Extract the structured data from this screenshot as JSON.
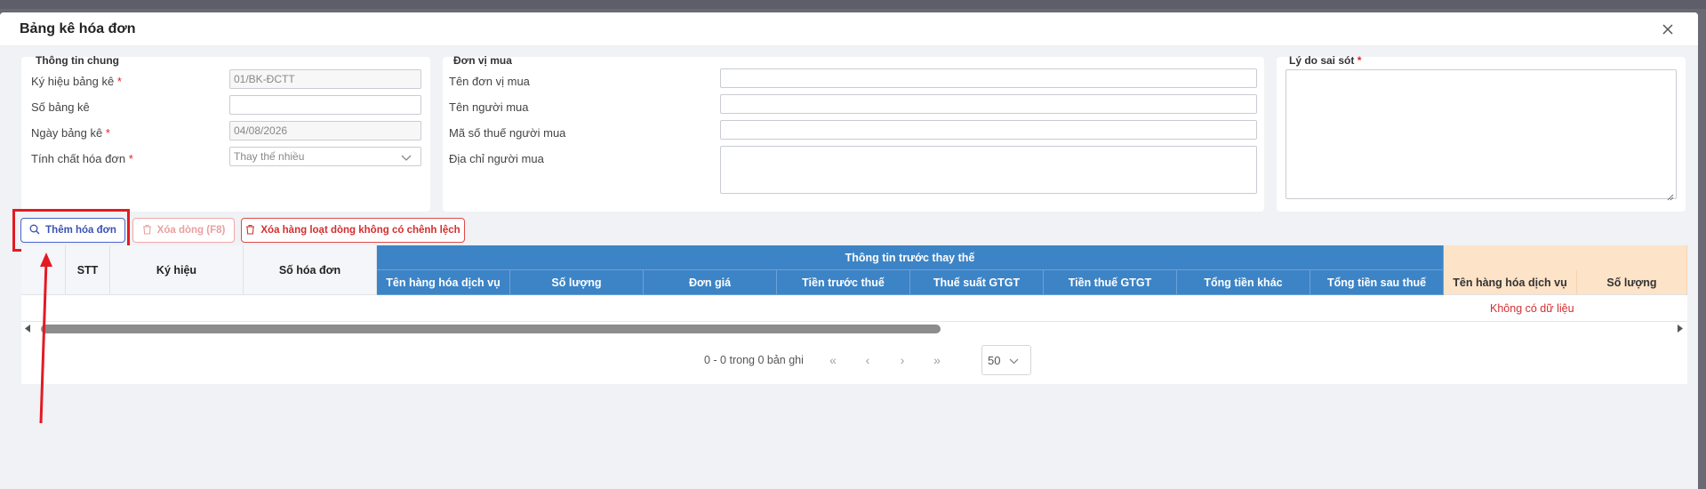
{
  "modal": {
    "title": "Bảng kê hóa đơn"
  },
  "general_info": {
    "legend": "Thông tin chung",
    "fields": {
      "ky_hieu": {
        "label": "Ký hiệu bảng kê",
        "required": "*",
        "value": "01/BK-ĐCTT"
      },
      "so_bang_ke": {
        "label": "Số bảng kê",
        "value": ""
      },
      "ngay_bang_ke": {
        "label": "Ngày bảng kê",
        "required": "*",
        "value": "04/08/2026"
      },
      "tinh_chat": {
        "label": "Tính chất hóa đơn",
        "required": "*",
        "value": "Thay thế nhiều"
      }
    }
  },
  "buyer": {
    "legend": "Đơn vị mua",
    "fields": {
      "ten_don_vi": {
        "label": "Tên đơn vị mua",
        "value": ""
      },
      "ten_nguoi_mua": {
        "label": "Tên người mua",
        "value": ""
      },
      "mst": {
        "label": "Mã số thuế người mua",
        "value": ""
      },
      "dia_chi": {
        "label": "Địa chỉ người mua",
        "value": ""
      }
    }
  },
  "reason": {
    "legend": "Lý do sai sót",
    "required": "*"
  },
  "toolbar": {
    "add_invoice": "Thêm hóa đơn",
    "delete_row": "Xóa dòng (F8)",
    "bulk_delete": "Xóa hàng loạt dòng không có chênh lệch"
  },
  "table": {
    "fixed_headers": [
      "STT",
      "Ký hiệu",
      "Số hóa đơn"
    ],
    "group_before": "Thông tin trước thay thế",
    "before_columns": [
      "Tên hàng hóa dịch vụ",
      "Số lượng",
      "Đơn giá",
      "Tiền trước thuế",
      "Thuế suất GTGT",
      "Tiền thuế GTGT",
      "Tổng tiền khác",
      "Tổng tiền sau thuế"
    ],
    "after_columns": [
      "Tên hàng hóa dịch vụ",
      "Số lượng"
    ],
    "empty_message": "Không có dữ liệu"
  },
  "pagination": {
    "summary": "0 - 0 trong 0 bản ghi",
    "page_size": "50"
  },
  "colors": {
    "header_blue": "#3d84c6",
    "peach": "#fde3c8",
    "highlight_red": "#e21b23",
    "primary": "#4a63c9"
  }
}
